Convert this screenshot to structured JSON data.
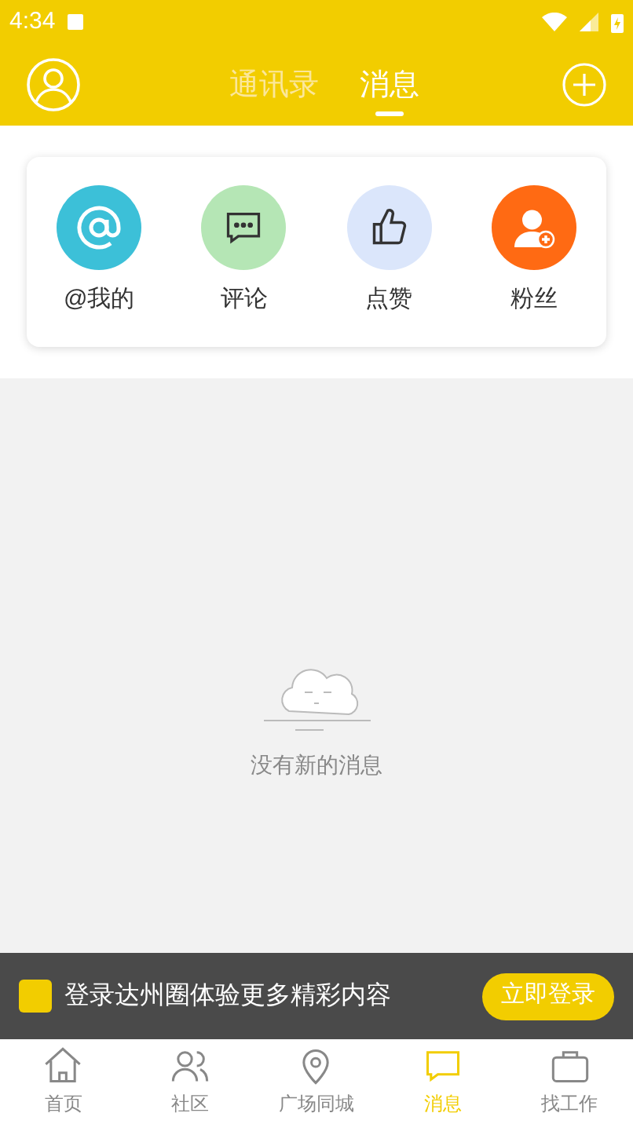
{
  "status_bar": {
    "time": "4:34"
  },
  "header": {
    "tabs": [
      {
        "label": "通讯录",
        "selected": false
      },
      {
        "label": "消息",
        "selected": true
      }
    ]
  },
  "categories": [
    {
      "label": "@我的",
      "kind": "at",
      "color": "#3cc0d8"
    },
    {
      "label": "评论",
      "kind": "comment",
      "color": "#b5e6b5"
    },
    {
      "label": "点赞",
      "kind": "like",
      "color": "#dbe6fb"
    },
    {
      "label": "粉丝",
      "kind": "fans",
      "color": "#ff6a13"
    }
  ],
  "empty_state": {
    "message": "没有新的消息"
  },
  "login_banner": {
    "text": "登录达州圈体验更多精彩内容",
    "button": "立即登录"
  },
  "bottom_nav": [
    {
      "label": "首页",
      "kind": "home",
      "selected": false
    },
    {
      "label": "社区",
      "kind": "community",
      "selected": false
    },
    {
      "label": "广场同城",
      "kind": "city",
      "selected": false
    },
    {
      "label": "消息",
      "kind": "message",
      "selected": true
    },
    {
      "label": "找工作",
      "kind": "job",
      "selected": false
    }
  ]
}
